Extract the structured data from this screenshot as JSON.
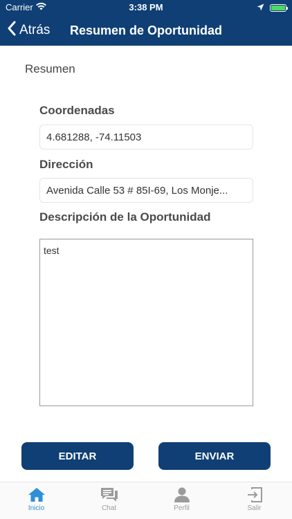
{
  "status_bar": {
    "carrier": "Carrier",
    "time": "3:38 PM"
  },
  "nav": {
    "back_label": "Atrás",
    "title": "Resumen de Oportunidad"
  },
  "content": {
    "section_title": "Resumen",
    "coordinates": {
      "label": "Coordenadas",
      "value": "4.681288, -74.11503"
    },
    "address": {
      "label": "Dirección",
      "value": "Avenida Calle 53 # 85I-69, Los Monje..."
    },
    "description": {
      "label": "Descripción de la Oportunidad",
      "value": "test"
    }
  },
  "buttons": {
    "edit_label": "EDITAR",
    "send_label": "ENVIAR"
  },
  "tabbar": {
    "items": [
      {
        "label": "Inicio",
        "icon": "home-icon",
        "active": true
      },
      {
        "label": "Chat",
        "icon": "chat-icon",
        "active": false
      },
      {
        "label": "Perfil",
        "icon": "person-icon",
        "active": false
      },
      {
        "label": "Salir",
        "icon": "logout-icon",
        "active": false
      }
    ]
  },
  "colors": {
    "primary": "#0f3f75",
    "tab_active": "#2f8fd8",
    "tab_inactive": "#9b9b9b",
    "battery": "#4cd964"
  }
}
